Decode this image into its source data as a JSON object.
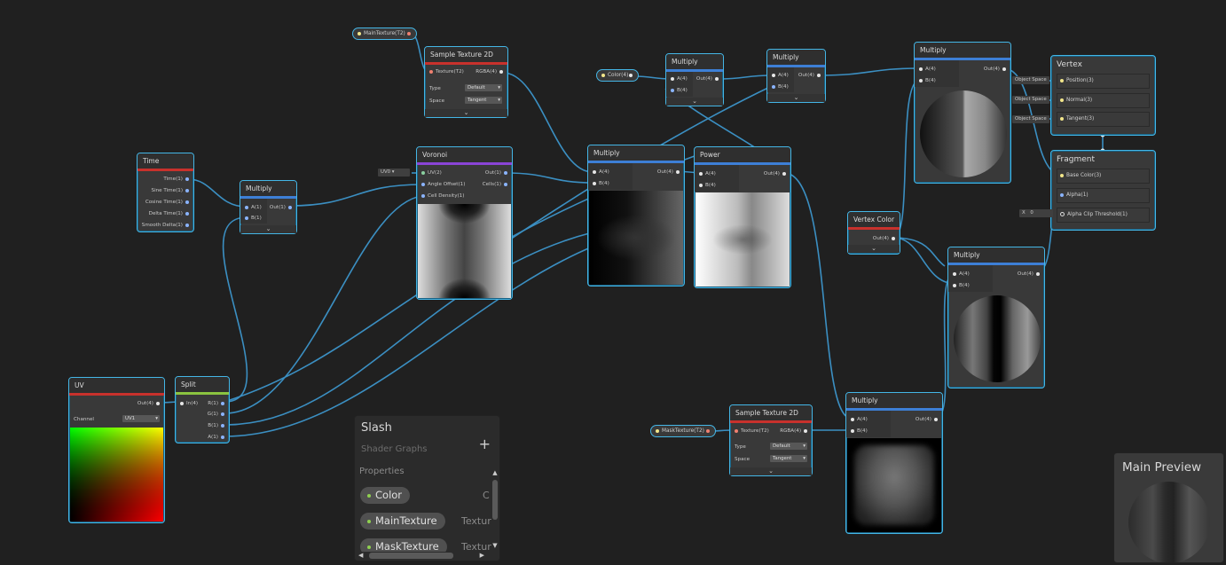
{
  "graph": {
    "nodes": {
      "main_texture_prop": {
        "label": "MainTexture(T2)"
      },
      "sample_tex_top": {
        "title": "Sample Texture 2D",
        "in_texture": "Texture(T2)",
        "out_rgba": "RGBA(4)",
        "type_label": "Type",
        "type_value": "Default",
        "space_label": "Space",
        "space_value": "Tangent"
      },
      "time": {
        "title": "Time",
        "outputs": [
          "Time(1)",
          "Sine Time(1)",
          "Cosine Time(1)",
          "Delta Time(1)",
          "Smooth Delta(1)"
        ]
      },
      "multiply_time": {
        "title": "Multiply",
        "in_a": "A(1)",
        "in_b": "B(1)",
        "out": "Out(1)"
      },
      "uv_select": {
        "value": "UV0"
      },
      "voronoi": {
        "title": "Voronoi",
        "in_uv": "UV(2)",
        "in_angle": "Angle Offset(1)",
        "in_density": "Cell Density(1)",
        "out_out": "Out(1)",
        "out_cells": "Cells(1)"
      },
      "color_prop": {
        "label": "Color(4)"
      },
      "multiply_mid": {
        "title": "Multiply",
        "in_a": "A(4)",
        "in_b": "B(4)",
        "out": "Out(4)"
      },
      "multiply_color": {
        "title": "Multiply",
        "in_a": "A(4)",
        "in_b": "B(4)",
        "out": "Out(4)"
      },
      "multiply_color2": {
        "title": "Multiply",
        "in_a": "A(4)",
        "in_b": "B(4)",
        "out": "Out(4)"
      },
      "power": {
        "title": "Power",
        "in_a": "A(4)",
        "in_b": "B(4)",
        "out": "Out(4)"
      },
      "multiply_topright": {
        "title": "Multiply",
        "in_a": "A(4)",
        "in_b": "B(4)",
        "out": "Out(4)"
      },
      "vertex_color": {
        "title": "Vertex Color",
        "out": "Out(4)"
      },
      "multiply_right": {
        "title": "Multiply",
        "in_a": "A(4)",
        "in_b": "B(4)",
        "out": "Out(4)"
      },
      "mask_texture_prop": {
        "label": "MaskTexture(T2)"
      },
      "sample_tex_bottom": {
        "title": "Sample Texture 2D",
        "in_texture": "Texture(T2)",
        "out_rgba": "RGBA(4)",
        "type_label": "Type",
        "type_value": "Default",
        "space_label": "Space",
        "space_value": "Tangent"
      },
      "multiply_bottom": {
        "title": "Multiply",
        "in_a": "A(4)",
        "in_b": "B(4)",
        "out": "Out(4)"
      },
      "uv": {
        "title": "UV",
        "out": "Out(4)",
        "channel_label": "Channel",
        "channel_value": "UV1"
      },
      "split": {
        "title": "Split",
        "in": "In(4)",
        "outputs": [
          "R(1)",
          "G(1)",
          "B(1)",
          "A(1)"
        ]
      }
    },
    "master": {
      "vertex": {
        "title": "Vertex",
        "slots": [
          "Position(3)",
          "Normal(3)",
          "Tangent(3)"
        ],
        "space_labels": [
          "Object Space",
          "Object Space",
          "Object Space"
        ]
      },
      "fragment": {
        "title": "Fragment",
        "slots": [
          "Base Color(3)",
          "Alpha(1)",
          "Alpha Clip Threshold(1)"
        ],
        "threshold_axis": "X",
        "threshold_value": "0"
      }
    }
  },
  "blackboard": {
    "title": "Slash",
    "subtitle": "Shader Graphs",
    "add_label": "+",
    "section_label": "Properties",
    "properties": [
      {
        "name": "Color",
        "type": "C"
      },
      {
        "name": "MainTexture",
        "type": "Textur"
      },
      {
        "name": "MaskTexture",
        "type": "Textur"
      }
    ]
  },
  "main_preview": {
    "title": "Main Preview"
  },
  "colors": {
    "background": "#202020",
    "node_border": "#44b6e6",
    "wire": "#3b8fc2",
    "texture_bar": "#c8312c",
    "math_bar": "#3d7fd6",
    "procedural_bar": "#8a44d6",
    "channel_bar": "#8bc340"
  }
}
